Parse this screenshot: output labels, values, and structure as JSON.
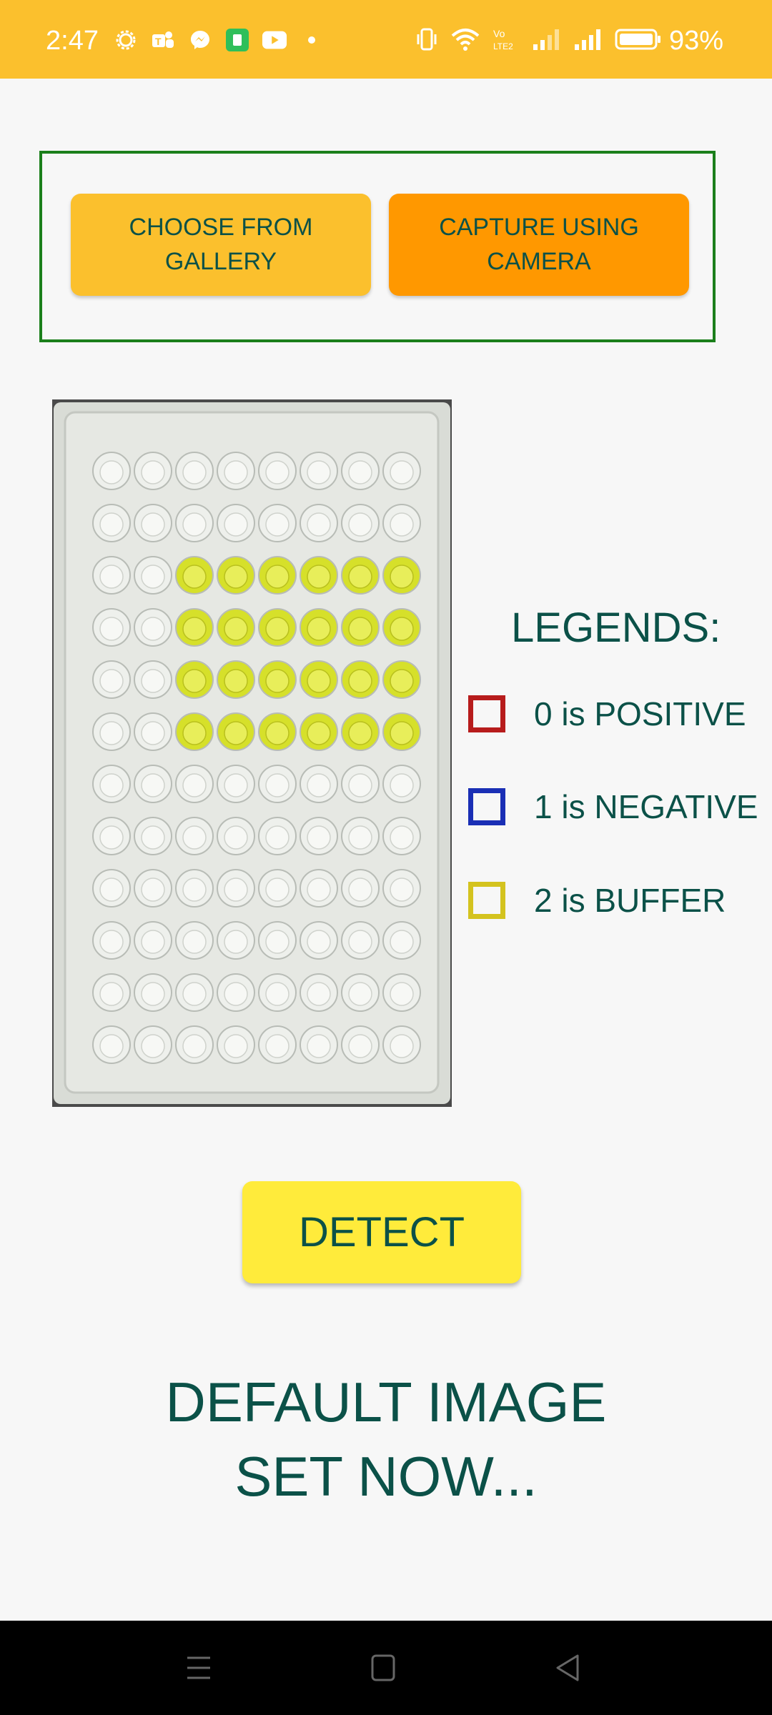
{
  "status_bar": {
    "time": "2:47",
    "battery": "93%",
    "notification_icons": [
      "settings-icon",
      "teams-icon",
      "messenger-icon",
      "app-icon",
      "youtube-icon",
      "dot-icon"
    ],
    "system_icons": [
      "vibrate-icon",
      "wifi-icon",
      "volte-icon",
      "signal-icon",
      "signal-icon",
      "battery-icon"
    ]
  },
  "actions": {
    "gallery_label": "CHOOSE FROM GALLERY",
    "camera_label": "CAPTURE USING CAMERA",
    "detect_label": "DETECT"
  },
  "legend": {
    "title": "LEGENDS:",
    "items": [
      {
        "label": "0 is POSITIVE",
        "color": "#b71c1c"
      },
      {
        "label": "1 is NEGATIVE",
        "color": "#1a2fb5"
      },
      {
        "label": "2 is BUFFER",
        "color": "#d4c31f"
      }
    ]
  },
  "status_message": "DEFAULT IMAGE SET NOW...",
  "colors": {
    "status_bar": "#fbc02d",
    "gallery_button": "#fbc02d",
    "camera_button": "#ff9800",
    "detect_button": "#ffeb3b",
    "text": "#0b5148",
    "frame": "#1b7f1b",
    "well_yellow": "#d6e02a"
  },
  "plate_image": {
    "rows": 12,
    "columns": 8,
    "yellow_rows": [
      2,
      3,
      4,
      5
    ],
    "yellow_columns": [
      2,
      3,
      4,
      5,
      6,
      7
    ]
  }
}
